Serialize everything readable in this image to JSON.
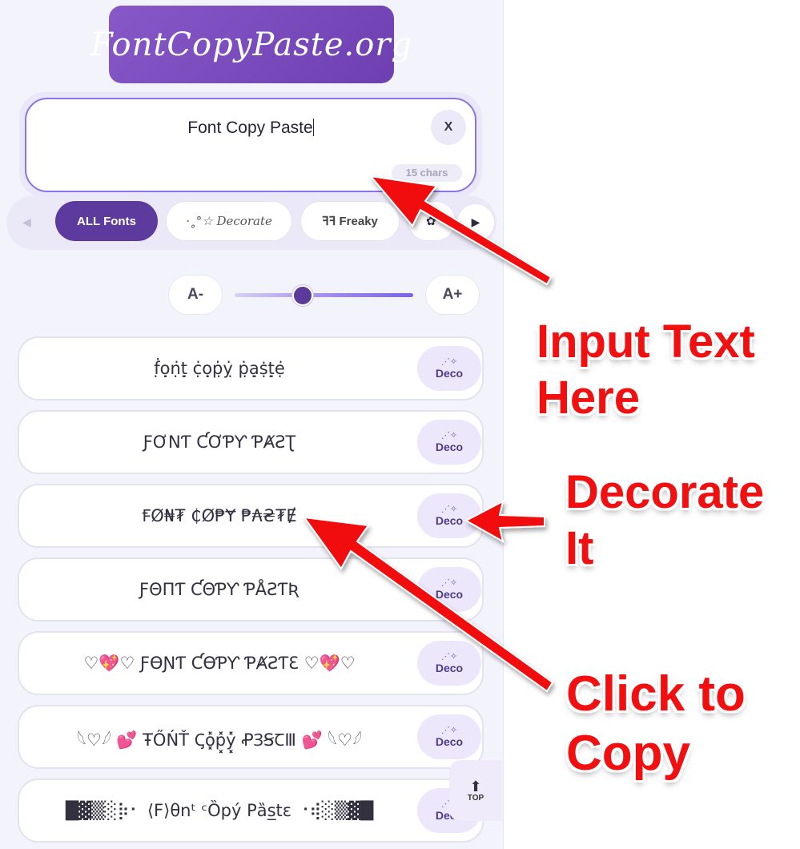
{
  "logo": {
    "text": "FontCopyPaste.org"
  },
  "input": {
    "value": "Font Copy Paste",
    "clear_label": "X",
    "char_count": "15 chars"
  },
  "tabs": [
    {
      "label": "ALL Fonts",
      "active": true
    },
    {
      "label": "⋅˳°☆ Decorate",
      "active": false
    },
    {
      "label": "ꟻꟻ Freaky",
      "active": false
    },
    {
      "label": "✿",
      "active": false
    }
  ],
  "size_controls": {
    "decrease": "A-",
    "increase": "A+",
    "level": 0.38
  },
  "results": [
    {
      "text": "ḟ̣ọ̣ṇ̇ṭ̣ ċ̣ọ̣ṗ̣ỵ̇ ṗ̣ạ̣ṩṭ̣ẹ̇",
      "deco": "Deco"
    },
    {
      "text": "ƑƠNƬ ƇƠƤƳ ƤȺƧƮ",
      "deco": "Deco"
    },
    {
      "text": "ꞘØ₦₮ ₵Ø₱Ɏ ₱₳₴₮Ɇ",
      "deco": "Deco"
    },
    {
      "text": "ƑΘΠƬ ƇΘƤƳ ƤÅƧƬƦ",
      "deco": "Deco"
    },
    {
      "text": "♡💖♡ ƑƟƝƬ ƇƟƤƳ ƤȺƧƬƐ ♡💖♡",
      "deco": "Deco"
    },
    {
      "text": "𓆩♡𓆪 💕 ŦŐŃŤ Ꞔo͓̽p͓̽y͓̽ ꝒꞫꞨꞆⅢ 💕 𓆩♡𓆪",
      "deco": "Deco"
    },
    {
      "text": "█▓▒░⡷⠂ ⟨F⟩θnᵗ ᶜȌpý Pȁs̲tɛ ⠐⢾░▒▓█",
      "deco": "Deco"
    }
  ],
  "scroll_top": {
    "label": "TOP"
  },
  "annotations": {
    "input": [
      "Input Text",
      "Here"
    ],
    "decorate": [
      "Decorate",
      "It"
    ],
    "copy": [
      "Click to",
      "Copy"
    ]
  },
  "colors": {
    "brand": "#6d3fb0",
    "accent": "#8b73e8",
    "annotation": "#f10f0f"
  }
}
